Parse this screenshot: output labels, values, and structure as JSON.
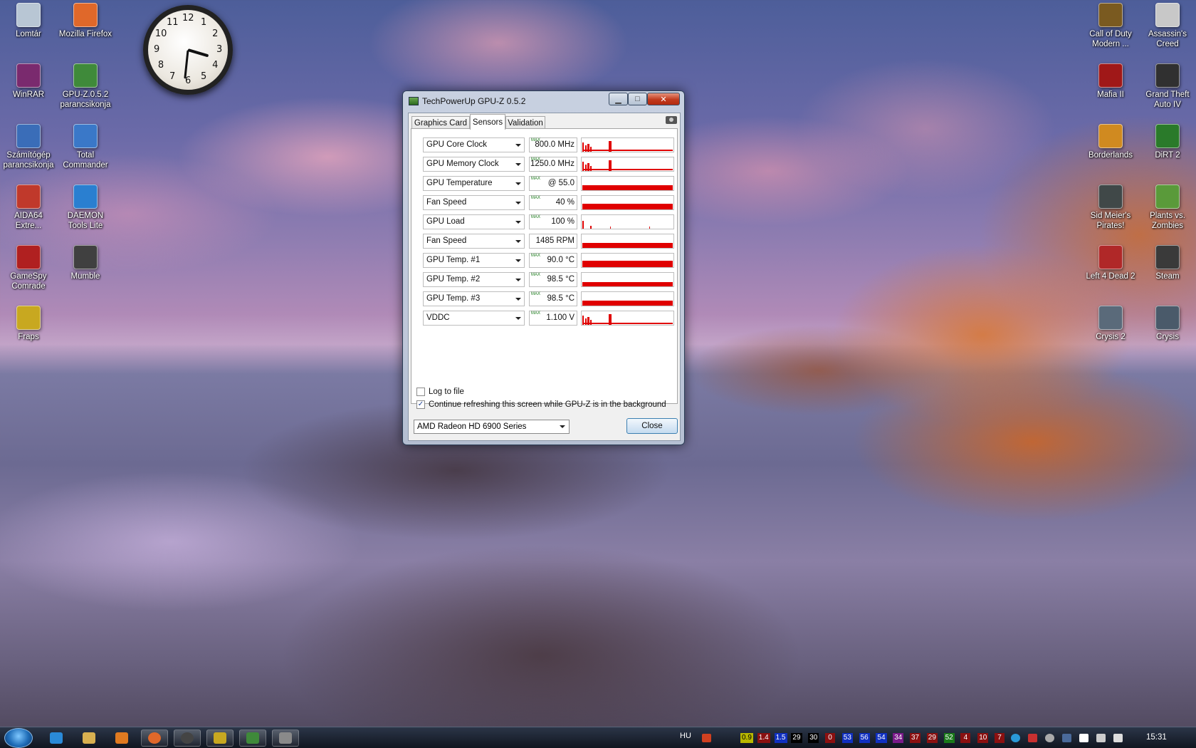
{
  "desktop": {
    "left_icons": [
      {
        "label": "Lomtár",
        "icon": "recycle-bin-icon",
        "color": "#b8c6d4"
      },
      {
        "label": "Mozilla Firefox",
        "icon": "firefox-icon",
        "color": "#e0682a"
      },
      {
        "label": "WinRAR",
        "icon": "winrar-icon",
        "color": "#7a2a6e"
      },
      {
        "label": "GPU-Z.0.5.2\nparancsikonja",
        "icon": "gpuz-shortcut-icon",
        "color": "#3f8a3a"
      },
      {
        "label": "Számítógép\nparancsikonja",
        "icon": "computer-shortcut-icon",
        "color": "#3a6db8"
      },
      {
        "label": "Total\nCommander",
        "icon": "total-commander-icon",
        "color": "#3a78c8"
      },
      {
        "label": "AIDA64\nExtre...",
        "icon": "aida64-icon",
        "color": "#c0392b"
      },
      {
        "label": "DAEMON\nTools Lite",
        "icon": "daemon-tools-icon",
        "color": "#2a7fd0"
      },
      {
        "label": "GameSpy\nComrade",
        "icon": "gamespy-icon",
        "color": "#b02020"
      },
      {
        "label": "Mumble",
        "icon": "mumble-icon",
        "color": "#404040"
      },
      {
        "label": "Fraps",
        "icon": "fraps-icon",
        "color": "#c8a820"
      }
    ],
    "right_icons": [
      {
        "label": "Call of Duty\nModern ...",
        "icon": "call-of-duty-icon",
        "color": "#7a5a20"
      },
      {
        "label": "Assassin's\nCreed",
        "icon": "assassins-creed-icon",
        "color": "#c8c8c8"
      },
      {
        "label": "Mafia II",
        "icon": "mafia-icon",
        "color": "#a01818"
      },
      {
        "label": "Grand Theft\nAuto IV",
        "icon": "gta-icon",
        "color": "#303030"
      },
      {
        "label": "Borderlands",
        "icon": "borderlands-icon",
        "color": "#d08a20"
      },
      {
        "label": "DiRT 2",
        "icon": "dirt-icon",
        "color": "#2a7a2a"
      },
      {
        "label": "Sid Meier's\nPirates!",
        "icon": "pirates-icon",
        "color": "#404848"
      },
      {
        "label": "Plants vs.\nZombies",
        "icon": "plants-vs-zombies-icon",
        "color": "#5a9a3a"
      },
      {
        "label": "Left 4 Dead 2",
        "icon": "left4dead-icon",
        "color": "#b02828"
      },
      {
        "label": "Steam",
        "icon": "steam-icon",
        "color": "#3a3a3a"
      },
      {
        "label": "Crysis 2",
        "icon": "crysis2-icon",
        "color": "#5a6a7a"
      },
      {
        "label": "Crysis",
        "icon": "crysis-icon",
        "color": "#4a5a6a"
      }
    ]
  },
  "clock": {
    "numbers": [
      "12",
      "1",
      "2",
      "3",
      "4",
      "5",
      "6",
      "7",
      "8",
      "9",
      "10",
      "11"
    ],
    "hour": 3.55,
    "minute": 31
  },
  "window": {
    "title": "TechPowerUp GPU-Z 0.5.2",
    "min_glyph": "▁",
    "max_glyph": "□",
    "close_glyph": "✕",
    "tabs": [
      "Graphics Card",
      "Sensors",
      "Validation"
    ],
    "active_tab": 1,
    "max_label": "MAX",
    "sensors": [
      {
        "name": "GPU Core Clock",
        "value": "800.0 MHz",
        "max": true
      },
      {
        "name": "GPU Memory Clock",
        "value": "1250.0 MHz",
        "max": true
      },
      {
        "name": "GPU Temperature",
        "value": "@ 55.0",
        "max": true
      },
      {
        "name": "Fan Speed",
        "value": "40 %",
        "max": true
      },
      {
        "name": "GPU Load",
        "value": "100 %",
        "max": true
      },
      {
        "name": "Fan Speed",
        "value": "1485 RPM",
        "max": false
      },
      {
        "name": "GPU Temp. #1",
        "value": "90.0 °C",
        "max": true
      },
      {
        "name": "GPU Temp. #2",
        "value": "98.5 °C",
        "max": true
      },
      {
        "name": "GPU Temp. #3",
        "value": "98.5 °C",
        "max": true
      },
      {
        "name": "VDDC",
        "value": "1.100 V",
        "max": true
      }
    ],
    "log_to_file_label": "Log to file",
    "log_to_file_checked": false,
    "continue_refresh_label": "Continue refreshing this screen while GPU-Z is in the background",
    "continue_refresh_checked": true,
    "check_glyph": "✓",
    "gpu_select_value": "AMD Radeon HD 6900 Series",
    "close_label": "Close",
    "graph_color": "#e00000"
  },
  "taskbar": {
    "language": "HU",
    "time": "15:31",
    "tray_numbers": [
      {
        "text": "0.9",
        "bg": "#b8b800",
        "fg": "#000000"
      },
      {
        "text": "1.4",
        "bg": "#8a1010",
        "fg": "#ffffff"
      },
      {
        "text": "1.5",
        "bg": "#1030c0",
        "fg": "#ffffff"
      },
      {
        "text": "29",
        "bg": "#000000",
        "fg": "#ffffff"
      },
      {
        "text": "30",
        "bg": "#000000",
        "fg": "#ffffff"
      },
      {
        "text": "0",
        "bg": "#8a1010",
        "fg": "#ffffff"
      },
      {
        "text": "53",
        "bg": "#1030c0",
        "fg": "#ffffff"
      },
      {
        "text": "56",
        "bg": "#1030c0",
        "fg": "#ffffff"
      },
      {
        "text": "54",
        "bg": "#1030c0",
        "fg": "#ffffff"
      },
      {
        "text": "34",
        "bg": "#7a1a8a",
        "fg": "#ffffff"
      },
      {
        "text": "37",
        "bg": "#8a1010",
        "fg": "#ffffff"
      },
      {
        "text": "29",
        "bg": "#8a1010",
        "fg": "#ffffff"
      },
      {
        "text": "52",
        "bg": "#1a7a1a",
        "fg": "#ffffff"
      },
      {
        "text": "4",
        "bg": "#8a1010",
        "fg": "#ffffff"
      },
      {
        "text": "10",
        "bg": "#8a1010",
        "fg": "#ffffff"
      },
      {
        "text": "7",
        "bg": "#8a1010",
        "fg": "#ffffff"
      }
    ]
  }
}
